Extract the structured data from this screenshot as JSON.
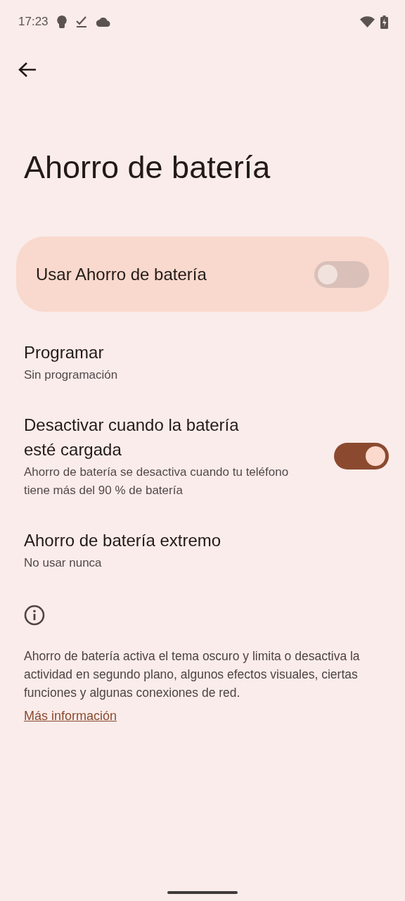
{
  "status_bar": {
    "time": "17:23"
  },
  "title": "Ahorro de batería",
  "main_switch": {
    "label": "Usar Ahorro de batería",
    "on": false
  },
  "items": [
    {
      "kind": "link",
      "title": "Programar",
      "summary": "Sin programación"
    },
    {
      "kind": "switch",
      "title": "Desactivar cuando la batería esté cargada",
      "summary": "Ahorro de batería se desactiva cuando tu teléfono tiene más del 90 % de batería",
      "on": true
    },
    {
      "kind": "link",
      "title": "Ahorro de batería extremo",
      "summary": "No usar nunca"
    }
  ],
  "footer": {
    "text": "Ahorro de batería activa el tema oscuro y limita o desactiva la actividad en segundo plano, algunos efectos visuales, ciertas funciones y algunas conexiones de red.",
    "link": "Más información"
  }
}
